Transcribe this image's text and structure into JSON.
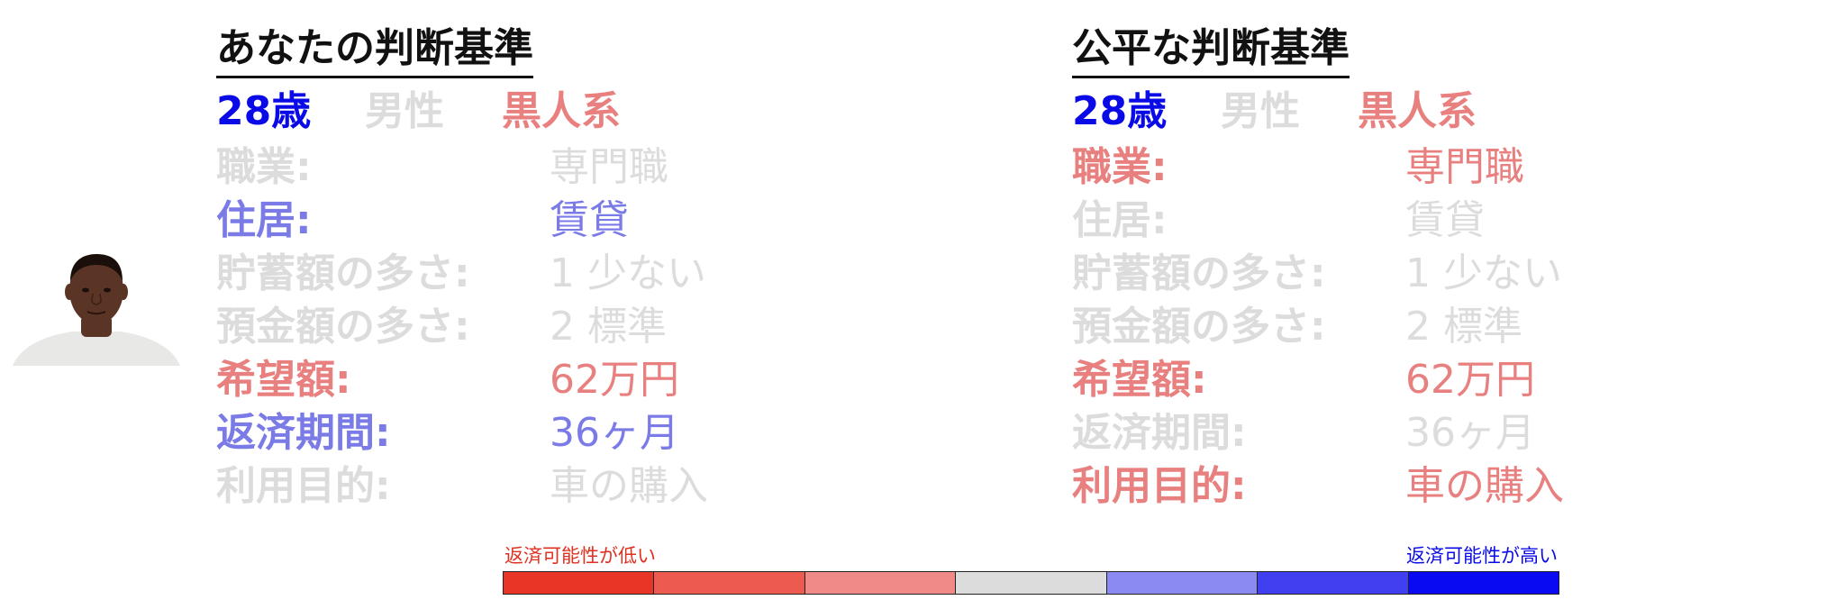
{
  "colors": {
    "strong_blue": "#0a0ae6",
    "medium_blue": "#7b7be8",
    "medium_red": "#e88080",
    "strong_red": "#e03020",
    "inactive": "#dcdcdc",
    "title": "#111111"
  },
  "avatar": {
    "icon": "person-photo-icon",
    "skin": "#5a3424",
    "shirt": "#e8e8e6"
  },
  "left": {
    "title": "あなたの判断基準",
    "demographics": {
      "age": {
        "text": "28歳",
        "color": "#0a0ae6"
      },
      "gender": {
        "text": "男性",
        "color": "#dcdcdc"
      },
      "race": {
        "text": "黒人系",
        "color": "#e88080"
      }
    },
    "rows": [
      {
        "label": "職業:",
        "value": "専門職",
        "label_color": "#dcdcdc",
        "value_color": "#dcdcdc",
        "bold": true
      },
      {
        "label": "住居:",
        "value": "賃貸",
        "label_color": "#7b7be8",
        "value_color": "#7b7be8",
        "bold": true
      },
      {
        "label": "貯蓄額の多さ:",
        "value": "1 少ない",
        "label_color": "#dcdcdc",
        "value_color": "#dcdcdc",
        "bold": true
      },
      {
        "label": "預金額の多さ:",
        "value": "2 標準",
        "label_color": "#dcdcdc",
        "value_color": "#dcdcdc",
        "bold": true
      },
      {
        "label": "希望額:",
        "value": "62万円",
        "label_color": "#e88080",
        "value_color": "#e88080",
        "bold": true
      },
      {
        "label": "返済期間:",
        "value": "36ヶ月",
        "label_color": "#7b7be8",
        "value_color": "#7b7be8",
        "bold": true
      },
      {
        "label": "利用目的:",
        "value": "車の購入",
        "label_color": "#dcdcdc",
        "value_color": "#dcdcdc",
        "bold": true
      }
    ]
  },
  "right": {
    "title": "公平な判断基準",
    "demographics": {
      "age": {
        "text": "28歳",
        "color": "#0a0ae6"
      },
      "gender": {
        "text": "男性",
        "color": "#dcdcdc"
      },
      "race": {
        "text": "黒人系",
        "color": "#e88080"
      }
    },
    "rows": [
      {
        "label": "職業:",
        "value": "専門職",
        "label_color": "#e88080",
        "value_color": "#e88080",
        "bold": true
      },
      {
        "label": "住居:",
        "value": "賃貸",
        "label_color": "#dcdcdc",
        "value_color": "#dcdcdc",
        "bold": true
      },
      {
        "label": "貯蓄額の多さ:",
        "value": "1 少ない",
        "label_color": "#dcdcdc",
        "value_color": "#dcdcdc",
        "bold": true
      },
      {
        "label": "預金額の多さ:",
        "value": "2 標準",
        "label_color": "#dcdcdc",
        "value_color": "#dcdcdc",
        "bold": true
      },
      {
        "label": "希望額:",
        "value": "62万円",
        "label_color": "#e88080",
        "value_color": "#e88080",
        "bold": true
      },
      {
        "label": "返済期間:",
        "value": "36ヶ月",
        "label_color": "#dcdcdc",
        "value_color": "#dcdcdc",
        "bold": true
      },
      {
        "label": "利用目的:",
        "value": "車の購入",
        "label_color": "#e88080",
        "value_color": "#e88080",
        "bold": true
      }
    ]
  },
  "legend": {
    "low_label": "返済可能性が低い",
    "high_label": "返済可能性が高い",
    "low_color": "#e03020",
    "high_color": "#0a0ae6",
    "segments": [
      "#e83525",
      "#ed5a50",
      "#f08a88",
      "#dcdcdc",
      "#8a8af2",
      "#4040f0",
      "#0a0af2"
    ]
  }
}
